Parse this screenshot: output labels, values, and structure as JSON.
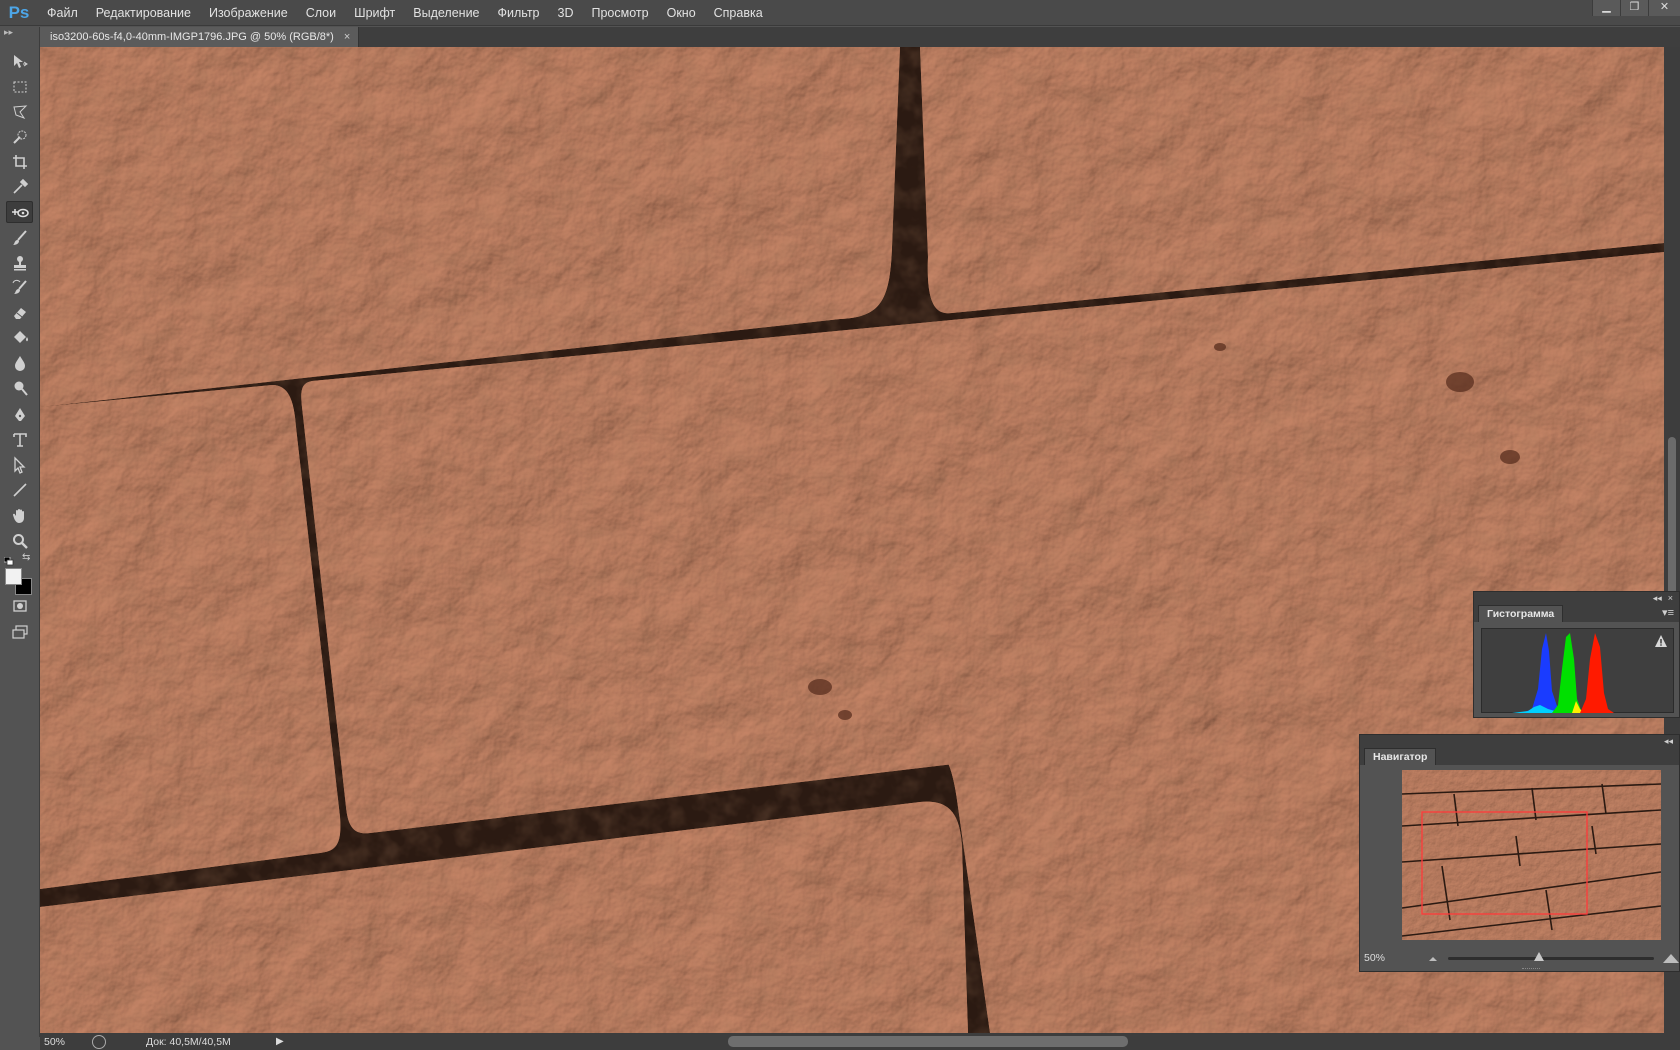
{
  "app": {
    "logo": "Ps",
    "menu": [
      "Файл",
      "Редактирование",
      "Изображение",
      "Слои",
      "Шрифт",
      "Выделение",
      "Фильтр",
      "3D",
      "Просмотр",
      "Окно",
      "Справка"
    ],
    "window_controls": [
      "minimize-icon",
      "restore-icon",
      "close-icon"
    ]
  },
  "document": {
    "tab_title": "iso3200-60s-f4,0-40mm-IMGP1796.JPG @ 50% (RGB/8*)",
    "tab_close": "×"
  },
  "tools": [
    "move-icon",
    "marquee-icon",
    "lasso-icon",
    "quick-selection-icon",
    "crop-icon",
    "eyedropper-icon",
    "spot-healing-icon",
    "brush-icon",
    "clone-stamp-icon",
    "history-brush-icon",
    "eraser-icon",
    "paint-bucket-icon",
    "blur-icon",
    "dodge-icon",
    "pen-icon",
    "type-icon",
    "path-selection-icon",
    "line-icon",
    "hand-icon",
    "zoom-icon"
  ],
  "active_tool": "spot-healing-icon",
  "colors": {
    "foreground": "#f2f2f2",
    "background": "#000000",
    "brick": "#b27456",
    "brick_light": "#c98a6a",
    "mortar": "#2b1a12",
    "histogram_blue": "#1a3cff",
    "histogram_green": "#00e000",
    "histogram_red": "#ff1a00"
  },
  "statusbar": {
    "zoom": "50%",
    "doc_info": "Док: 40,5M/40,5M",
    "arrow": "▶"
  },
  "histogram_panel": {
    "tab": "Гистограмма",
    "collapse": "◂◂",
    "close": "×",
    "menu": "▾≡",
    "warning": "warning-icon"
  },
  "navigator_panel": {
    "tab": "Навигатор",
    "collapse": "◂◂",
    "zoom": "50%",
    "zoom_slider_level": 0.44
  }
}
